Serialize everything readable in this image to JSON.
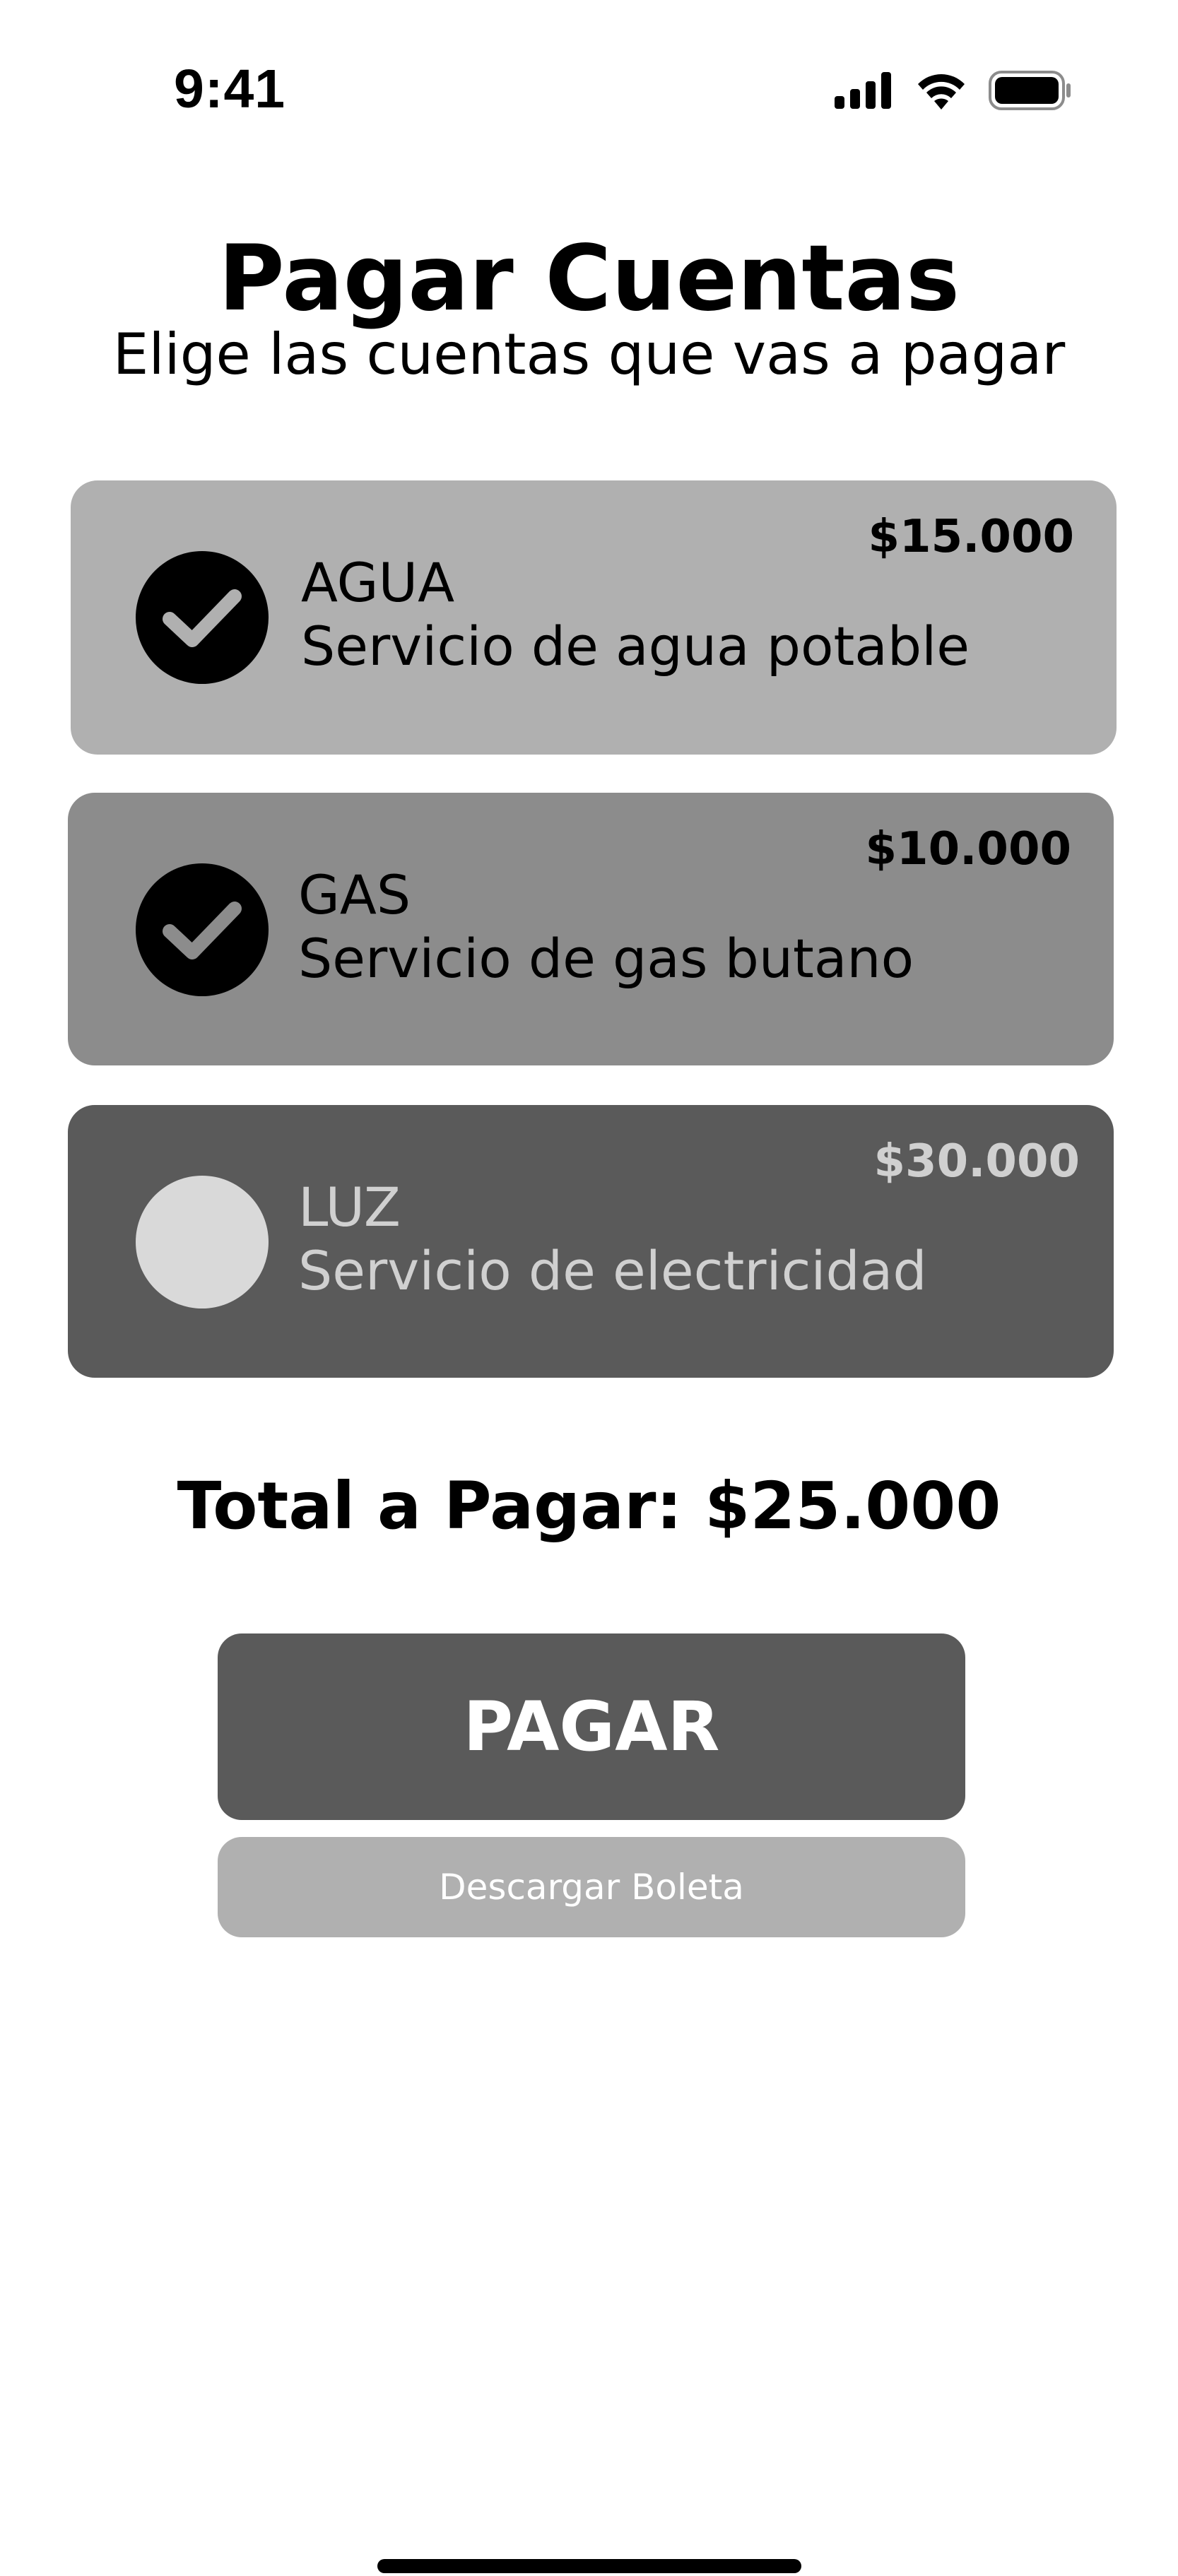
{
  "status_bar": {
    "time": "9:41",
    "icons": [
      "cellular-signal-icon",
      "wifi-icon",
      "battery-icon"
    ]
  },
  "header": {
    "title": "Pagar Cuentas",
    "subtitle": "Elige las cuentas que vas a pagar"
  },
  "bills": [
    {
      "name": "AGUA",
      "description": "Servicio de agua potable",
      "amount": "$15.000",
      "selected": true,
      "card_color": "#b0b0b0"
    },
    {
      "name": "GAS",
      "description": "Servicio de gas butano",
      "amount": "$10.000",
      "selected": true,
      "card_color": "#8c8c8c"
    },
    {
      "name": "LUZ",
      "description": "Servicio de electricidad",
      "amount": "$30.000",
      "selected": false,
      "card_color": "#5a5a5a"
    }
  ],
  "total": {
    "text": "Total a Pagar: $25.000"
  },
  "actions": {
    "pay_label": "PAGAR",
    "download_label": "Descargar Boleta"
  },
  "colors": {
    "primary_button": "#5a5a5a",
    "secondary_button": "#b0b0b0",
    "check_selected": "#000000",
    "check_unselected": "#d9d9d9"
  }
}
